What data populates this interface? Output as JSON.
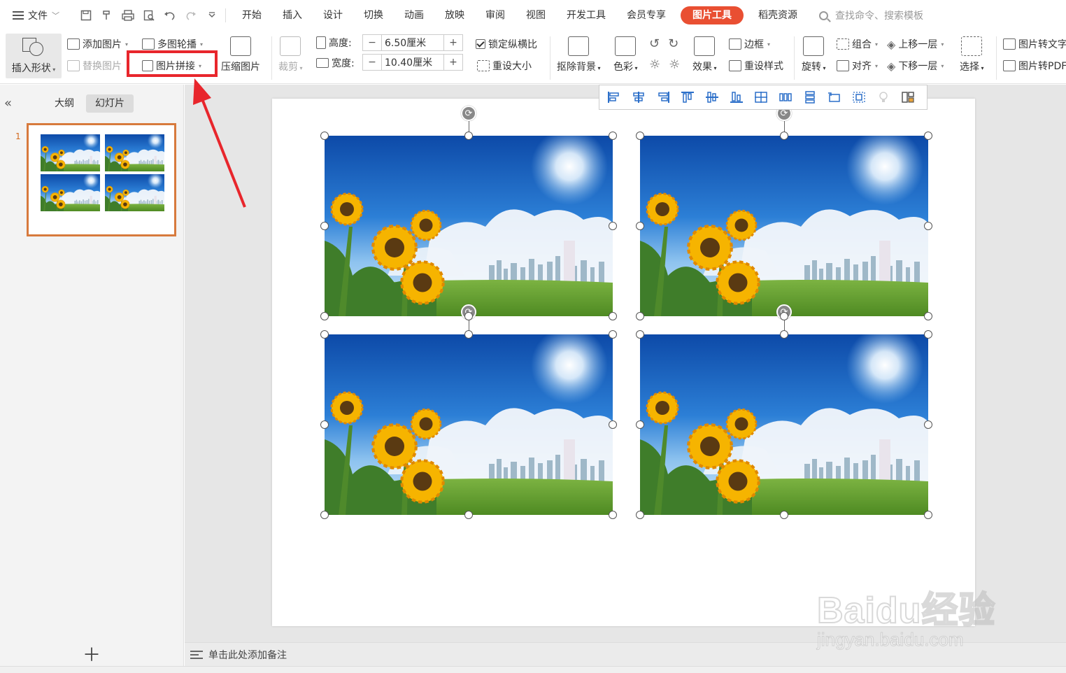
{
  "menubar": {
    "file_label": "文件",
    "tabs": [
      "开始",
      "插入",
      "设计",
      "切换",
      "动画",
      "放映",
      "审阅",
      "视图",
      "开发工具",
      "会员专享",
      "图片工具",
      "稻壳资源"
    ],
    "active_tab": "图片工具",
    "search_placeholder": "查找命令、搜索模板"
  },
  "ribbon": {
    "insert_shape": "插入形状",
    "add_picture": "添加图片",
    "replace_picture": "替换图片",
    "multi_carousel": "多图轮播",
    "picture_collage": "图片拼接",
    "compress_picture": "压缩图片",
    "crop": "裁剪",
    "height_label": "高度:",
    "height_value": "6.50厘米",
    "width_label": "宽度:",
    "width_value": "10.40厘米",
    "lock_ratio": "锁定纵横比",
    "reset_size": "重设大小",
    "remove_bg": "抠除背景",
    "color": "色彩",
    "effects": "效果",
    "border": "边框",
    "reset_style": "重设样式",
    "rotate": "旋转",
    "group": "组合",
    "align": "对齐",
    "bring_forward": "上移一层",
    "send_backward": "下移一层",
    "select": "选择",
    "picture_to_text": "图片转文字",
    "picture_to_pdf": "图片转PDF"
  },
  "left_panel": {
    "tab_outline": "大纲",
    "tab_slides": "幻灯片",
    "slide_number": "1"
  },
  "notes": {
    "placeholder": "单击此处添加备注"
  },
  "watermark": {
    "logo": "Baidu经验",
    "url": "jingyan.baidu.com"
  },
  "colors": {
    "accent": "#e94f32",
    "highlight_box": "#e8262c",
    "thumb_border": "#d77a3d"
  }
}
